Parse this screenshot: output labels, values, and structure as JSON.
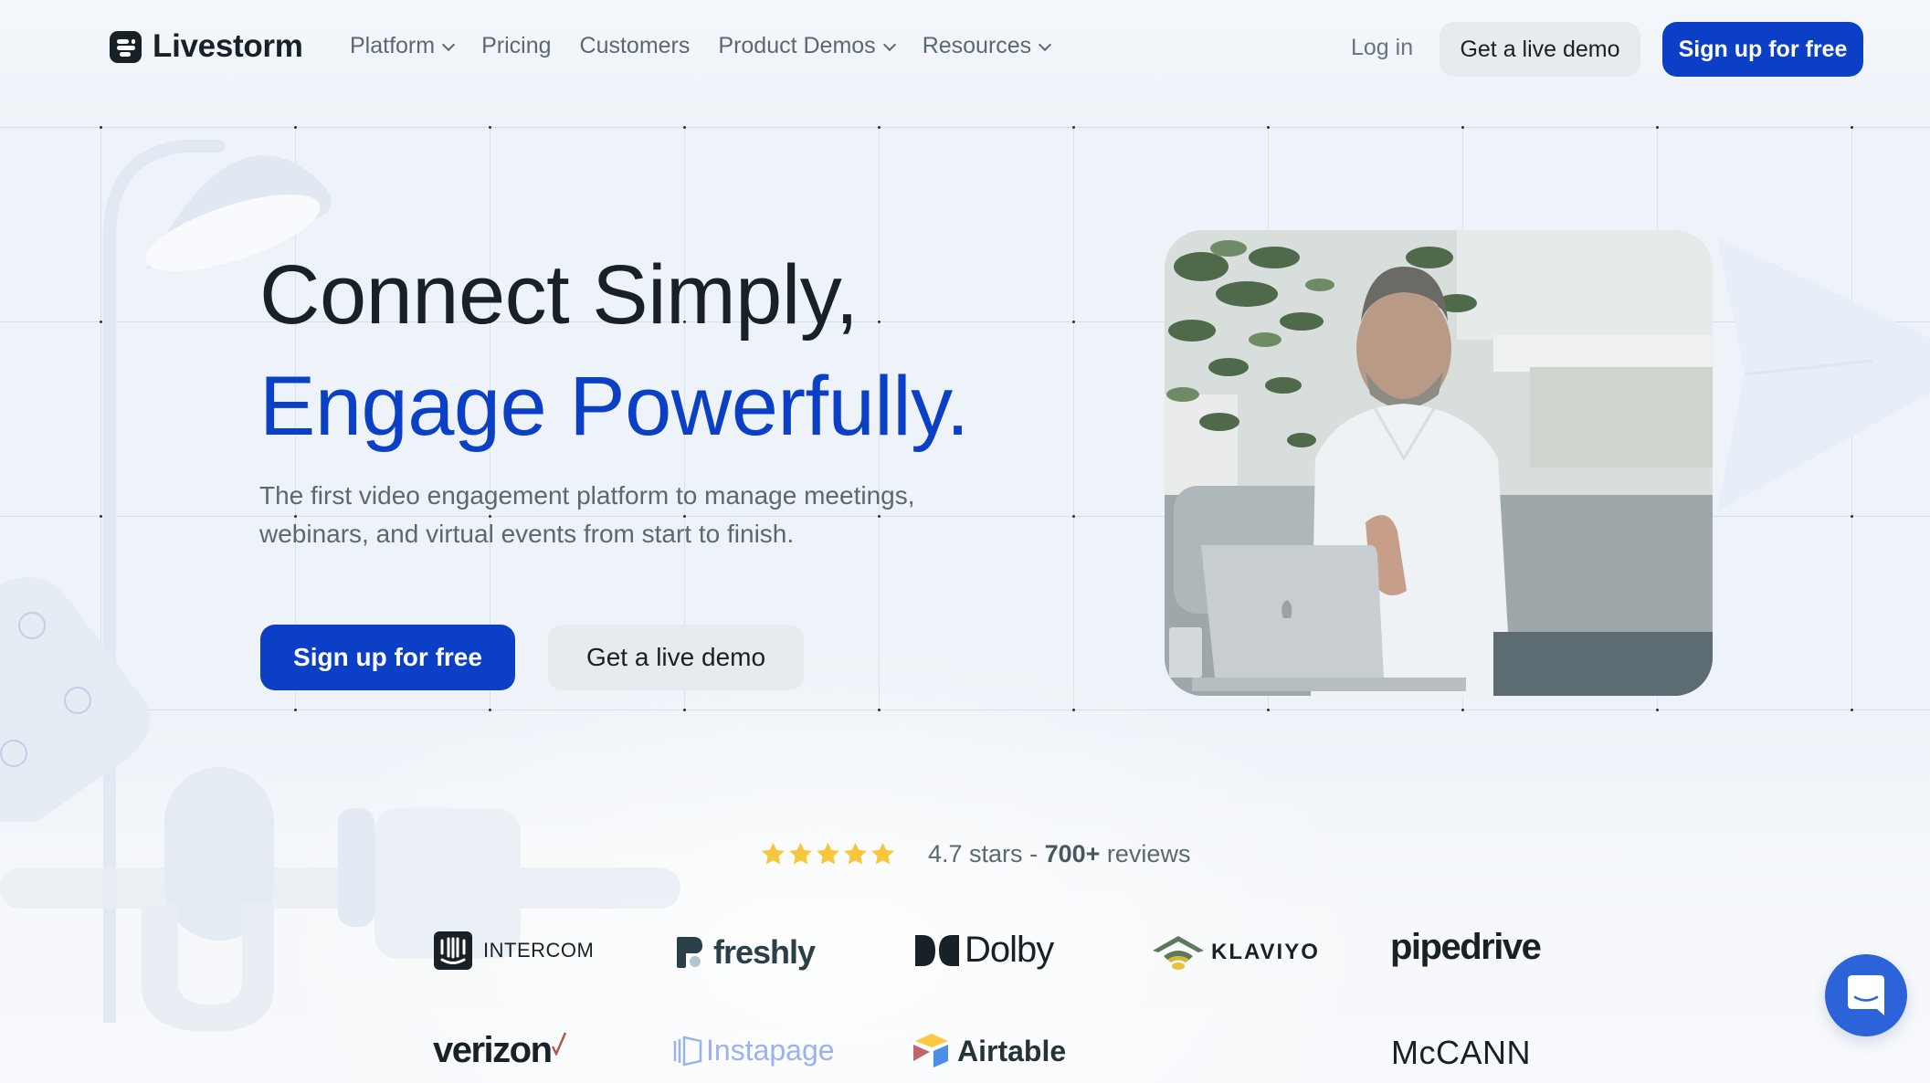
{
  "header": {
    "brand": "Livestorm",
    "nav": [
      {
        "label": "Platform",
        "dropdown": true
      },
      {
        "label": "Pricing",
        "dropdown": false
      },
      {
        "label": "Customers",
        "dropdown": false
      },
      {
        "label": "Product Demos",
        "dropdown": true
      },
      {
        "label": "Resources",
        "dropdown": true
      }
    ],
    "login_label": "Log in",
    "demo_label": "Get a live demo",
    "signup_label": "Sign up for free"
  },
  "hero": {
    "headline_line1": "Connect Simply,",
    "headline_line2": "Engage Powerfully.",
    "subtext": "The first video engagement platform to manage meetings, webinars, and virtual events from start to finish.",
    "primary_cta": "Sign up for free",
    "secondary_cta": "Get a live demo",
    "video_alt": "Man in white shirt on a video call with a laptop"
  },
  "rating": {
    "stars": 5,
    "score_text": "4.7 stars",
    "separator": "-",
    "reviews_count": "700+",
    "reviews_label": "reviews"
  },
  "customers": {
    "row1": [
      "INTERCOM",
      "freshly",
      "Dolby",
      "KLAVIYO",
      "pipedrive"
    ],
    "row2": [
      "verizon",
      "Instapage",
      "Airtable",
      "McCANN"
    ]
  },
  "chat_widget": {
    "icon": "chat-bubble-icon"
  },
  "colors": {
    "brand_blue": "#0b40c6",
    "text_dark": "#172126",
    "text_muted": "#5a6970",
    "star_yellow": "#f7c63b",
    "chat_blue": "#2d63d8"
  }
}
